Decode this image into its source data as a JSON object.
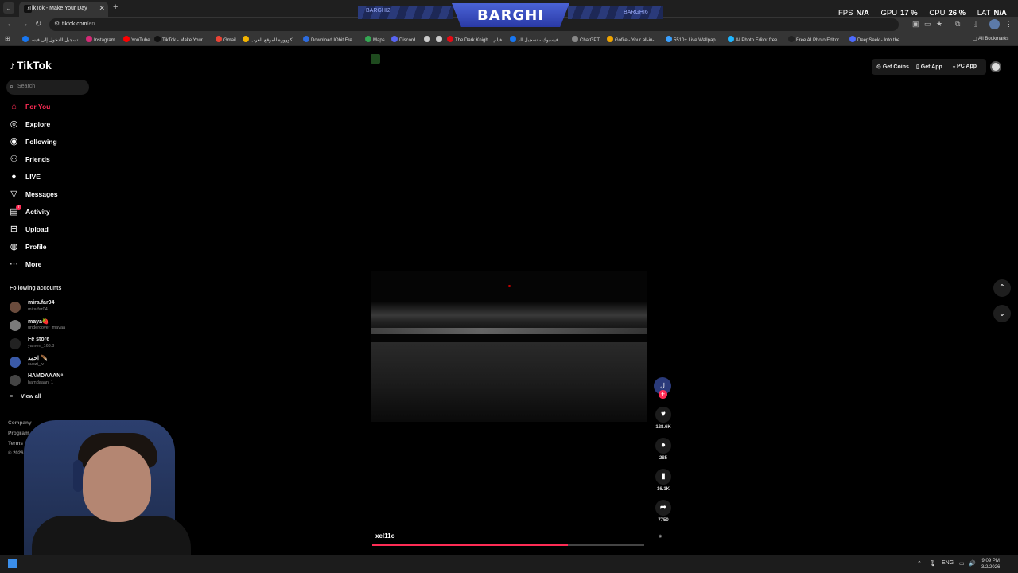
{
  "browser": {
    "tab_title": "TikTok - Make Your Day",
    "url_host": "tiktok.com",
    "url_path": "/en",
    "bookmarks": [
      {
        "label": "تسجيل الدخول إلى فيسـ",
        "color": "#1877f2"
      },
      {
        "label": "Instagram",
        "color": "#d62976"
      },
      {
        "label": "YouTube",
        "color": "#ff0000"
      },
      {
        "label": "TikTok - Make Your...",
        "color": "#111111"
      },
      {
        "label": "Gmail",
        "color": "#ea4335"
      },
      {
        "label": "كووورة الموقع العرب...",
        "color": "#f4b400"
      },
      {
        "label": "Download IObit Fre...",
        "color": "#2d6cdf"
      },
      {
        "label": "Maps",
        "color": "#34a853"
      },
      {
        "label": "Discord",
        "color": "#5865f2"
      },
      {
        "label": "",
        "color": "#cccccc"
      },
      {
        "label": "",
        "color": "#cccccc"
      },
      {
        "label": "The Dark Knigh... فيلم",
        "color": "#e50914"
      },
      {
        "label": "فيسبوك - تسجيل الد...",
        "color": "#1877f2"
      },
      {
        "label": "ChatGPT",
        "color": "#888888"
      },
      {
        "label": "Gofile - Your all-in-...",
        "color": "#f0a500"
      },
      {
        "label": "5510+ Live Wallpap...",
        "color": "#3aa0ff"
      },
      {
        "label": "AI Photo Editor free...",
        "color": "#1fb6ff"
      },
      {
        "label": "Free AI Photo Editor...",
        "color": "#222222"
      },
      {
        "label": "DeepSeek - Into the...",
        "color": "#4d6bfe"
      }
    ],
    "all_bookmarks": "All Bookmarks"
  },
  "overlay": {
    "banner_center": "BARGHI",
    "banner_left": "BARGHI2",
    "banner_right": "BARGHI6"
  },
  "hud": {
    "fps_label": "FPS",
    "fps_value": "N/A",
    "gpu_label": "GPU",
    "gpu_value": "17 %",
    "cpu_label": "CPU",
    "cpu_value": "26 %",
    "lat_label": "LAT",
    "lat_value": "N/A"
  },
  "sidebar": {
    "logo": "TikTok",
    "search_placeholder": "Search",
    "nav": [
      {
        "label": "For You",
        "icon": "home-icon"
      },
      {
        "label": "Explore",
        "icon": "compass-icon"
      },
      {
        "label": "Following",
        "icon": "following-icon"
      },
      {
        "label": "Friends",
        "icon": "friends-icon"
      },
      {
        "label": "LIVE",
        "icon": "live-icon"
      },
      {
        "label": "Messages",
        "icon": "messages-icon"
      },
      {
        "label": "Activity",
        "icon": "activity-icon",
        "badge": "7"
      },
      {
        "label": "Upload",
        "icon": "upload-icon"
      },
      {
        "label": "Profile",
        "icon": "profile-icon"
      },
      {
        "label": "More",
        "icon": "more-icon"
      }
    ],
    "following_header": "Following accounts",
    "accounts": [
      {
        "name": "mira.far04",
        "handle": "mira.far04"
      },
      {
        "name": "maya🍓",
        "handle": "undercover_mayaa"
      },
      {
        "name": "Fe store",
        "handle": "yamen_163.8"
      },
      {
        "name": "احمد 🪶",
        "handle": "subzi_tv"
      },
      {
        "name": "HAMDAAAN⁸",
        "handle": "hamdaaan_1"
      }
    ],
    "view_all": "View all",
    "footer": [
      "Company",
      "Program",
      "Terms & Policies",
      "© 2026 TikTok"
    ]
  },
  "topbar": {
    "get_coins": "Get Coins",
    "get_app": "Get App",
    "pc_app": "PC App"
  },
  "video": {
    "author": "xel11o",
    "progress": 0.72,
    "likes": "128.6K",
    "comments": "285",
    "saves": "16.1K",
    "shares": "7750",
    "creator_initial": "ل"
  },
  "taskbar": {
    "lang": "ENG",
    "time": "9:09 PM",
    "date": "3/2/2026"
  },
  "colors": {
    "accent": "#fe2c55",
    "chrome_bg": "#353535",
    "overlay_blue": "#4b63d6"
  }
}
